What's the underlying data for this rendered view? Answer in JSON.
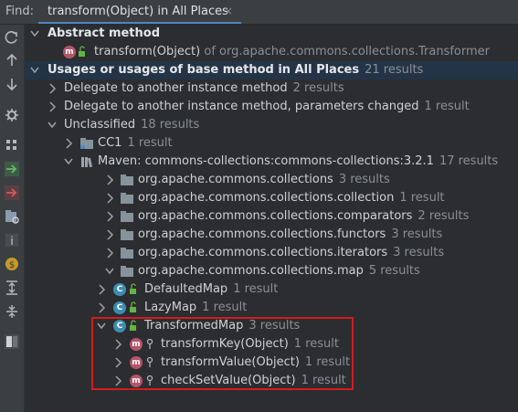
{
  "find": {
    "label": "Find:",
    "tab_title": "transform(Object) in All Places",
    "close_glyph": "×"
  },
  "toolbar": [
    "refresh-icon",
    "arrow-up-icon",
    "arrow-down-icon",
    "settings-icon",
    "group-icon",
    "navigate-in-icon",
    "navigate-out-icon",
    "preview-icon",
    "info-icon",
    "coin-icon",
    "expand-all-icon",
    "collapse-all-icon",
    "layout-icon"
  ],
  "tree": {
    "abstract_header": "Abstract method",
    "abstract_item": {
      "name": "transform(Object)",
      "suffix": "of org.apache.commons.collections.Transformer"
    },
    "usages_header": {
      "label": "Usages or usages of base method in All Places",
      "count": "21 results"
    },
    "delegate1": {
      "label": "Delegate to another instance method",
      "count": "2 results"
    },
    "delegate2": {
      "label": "Delegate to another instance method, parameters changed",
      "count": "1 result"
    },
    "unclassified": {
      "label": "Unclassified",
      "count": "18 results"
    },
    "cc1": {
      "label": "CC1",
      "count": "1 result"
    },
    "maven": {
      "label": "Maven: commons-collections:commons-collections:3.2.1",
      "count": "17 results"
    },
    "packages": [
      {
        "label": "org.apache.commons.collections",
        "count": "3 results"
      },
      {
        "label": "org.apache.commons.collections.collection",
        "count": "1 result"
      },
      {
        "label": "org.apache.commons.collections.comparators",
        "count": "2 results"
      },
      {
        "label": "org.apache.commons.collections.functors",
        "count": "3 results"
      },
      {
        "label": "org.apache.commons.collections.iterators",
        "count": "3 results"
      },
      {
        "label": "org.apache.commons.collections.map",
        "count": "5 results"
      }
    ],
    "classes": [
      {
        "label": "DefaultedMap",
        "count": "1 result"
      },
      {
        "label": "LazyMap",
        "count": "1 result"
      },
      {
        "label": "TransformedMap",
        "count": "3 results"
      }
    ],
    "methods": [
      {
        "label": "transformKey(Object)",
        "count": "1 result"
      },
      {
        "label": "transformValue(Object)",
        "count": "1 result"
      },
      {
        "label": "checkSetValue(Object)",
        "count": "1 result"
      }
    ],
    "class_badge": "C",
    "method_badge": "m"
  },
  "colors": {
    "accent": "#4a88c7",
    "highlight_box": "#d21d1d",
    "class_icon": "#3d8db0",
    "method_icon": "#b4556a"
  }
}
